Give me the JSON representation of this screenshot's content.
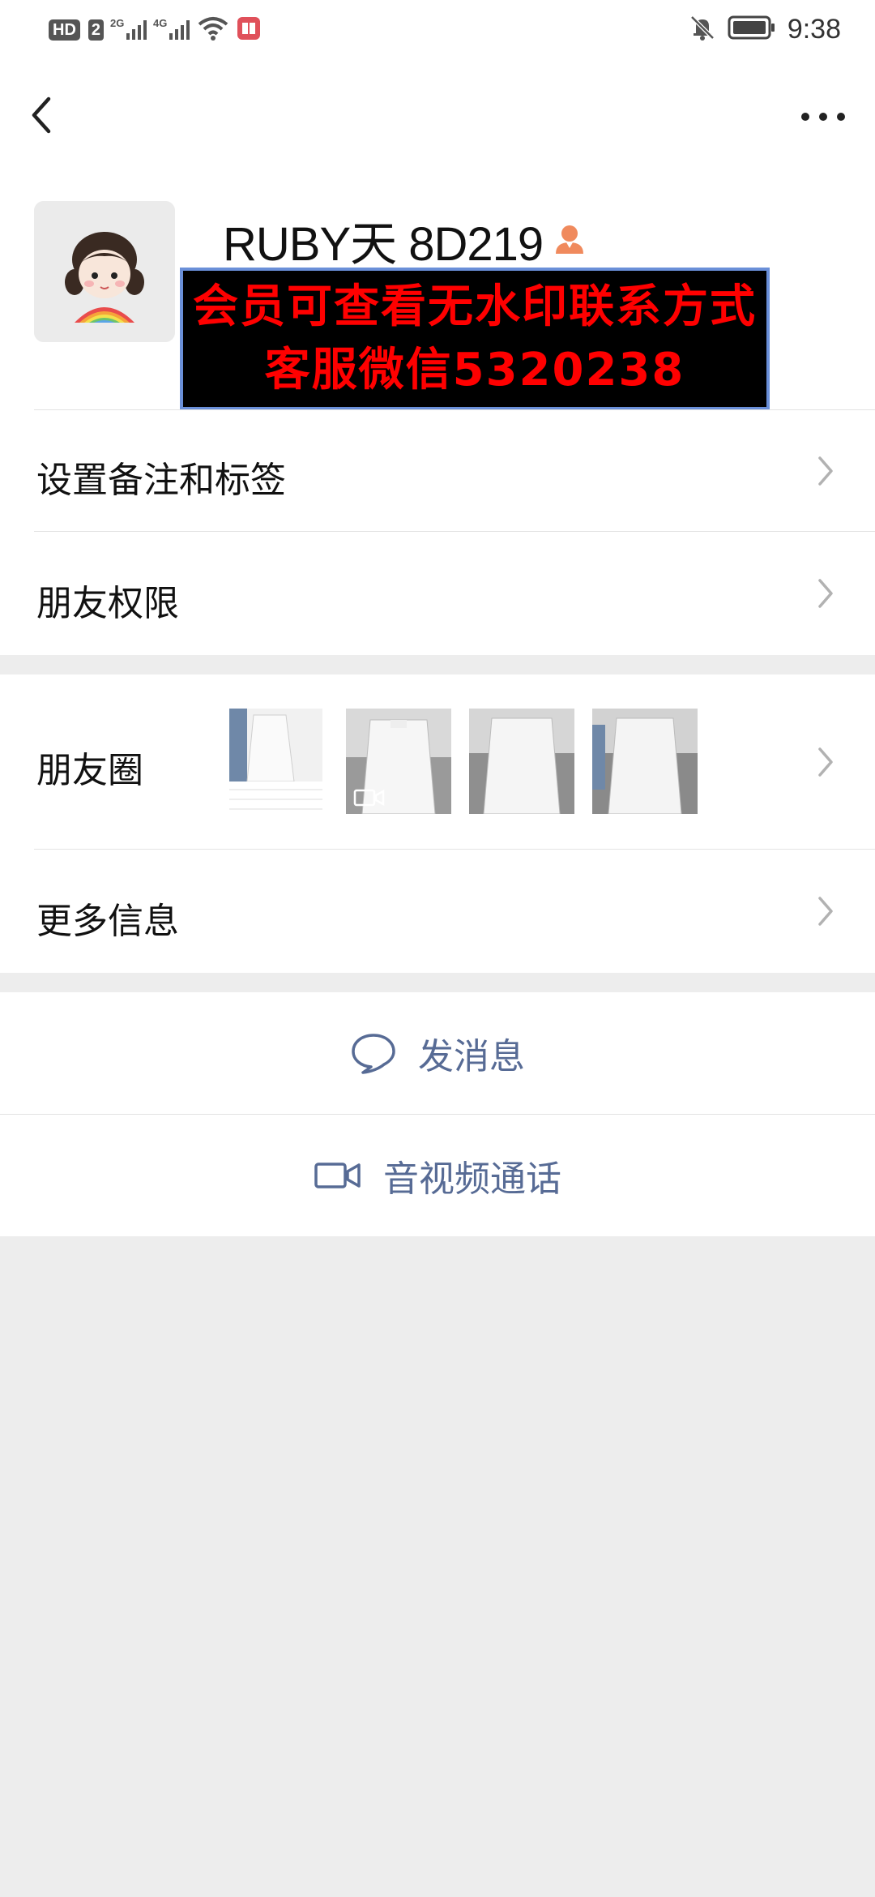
{
  "status_bar": {
    "hd": "HD",
    "sim": "2",
    "net1": "2G",
    "net2": "4G",
    "time": "9:38"
  },
  "profile": {
    "nickname": "RUBY天 8D219",
    "banner_line1": "会员可查看无水印联系方式",
    "banner_line2": "客服微信5320238"
  },
  "rows": {
    "remark": "设置备注和标签",
    "permission": "朋友权限",
    "moments": "朋友圈",
    "more_info": "更多信息"
  },
  "actions": {
    "message": "发消息",
    "call": "音视频通话"
  },
  "colors": {
    "link": "#576b95",
    "banner_text": "#ff0000",
    "background": "#ededed"
  }
}
